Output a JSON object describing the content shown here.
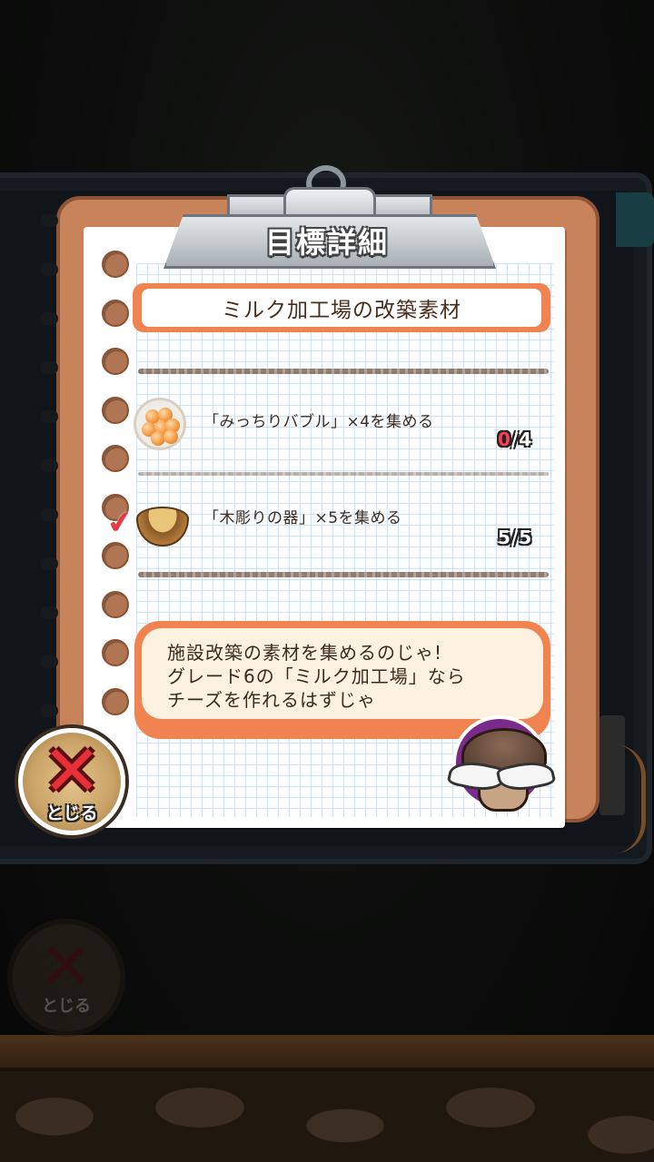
{
  "dialog": {
    "title": "目標詳細",
    "header": "ミルク加工場の改築素材",
    "tasks": [
      {
        "icon": "orange-bubbles-icon",
        "text": "「みっちりバブル」×4を集める",
        "current": "0",
        "separator": "/",
        "total": "4",
        "completed": false
      },
      {
        "icon": "wooden-bowl-icon",
        "text": "「木彫りの器」×5を集める",
        "current": "5",
        "separator": "/",
        "total": "5",
        "completed": true
      }
    ],
    "message_lines": [
      "施設改築の素材を集めるのじゃ!",
      "グレード6の「ミルク加工場」なら",
      "チーズを作れるはずじゃ"
    ],
    "close_label": "とじる"
  },
  "background": {
    "close_label": "とじる"
  },
  "colors": {
    "accent_orange": "#f08350",
    "clipboard_brown": "#c9835a",
    "count_red": "#ff3e55",
    "close_red": "#e8303a"
  }
}
